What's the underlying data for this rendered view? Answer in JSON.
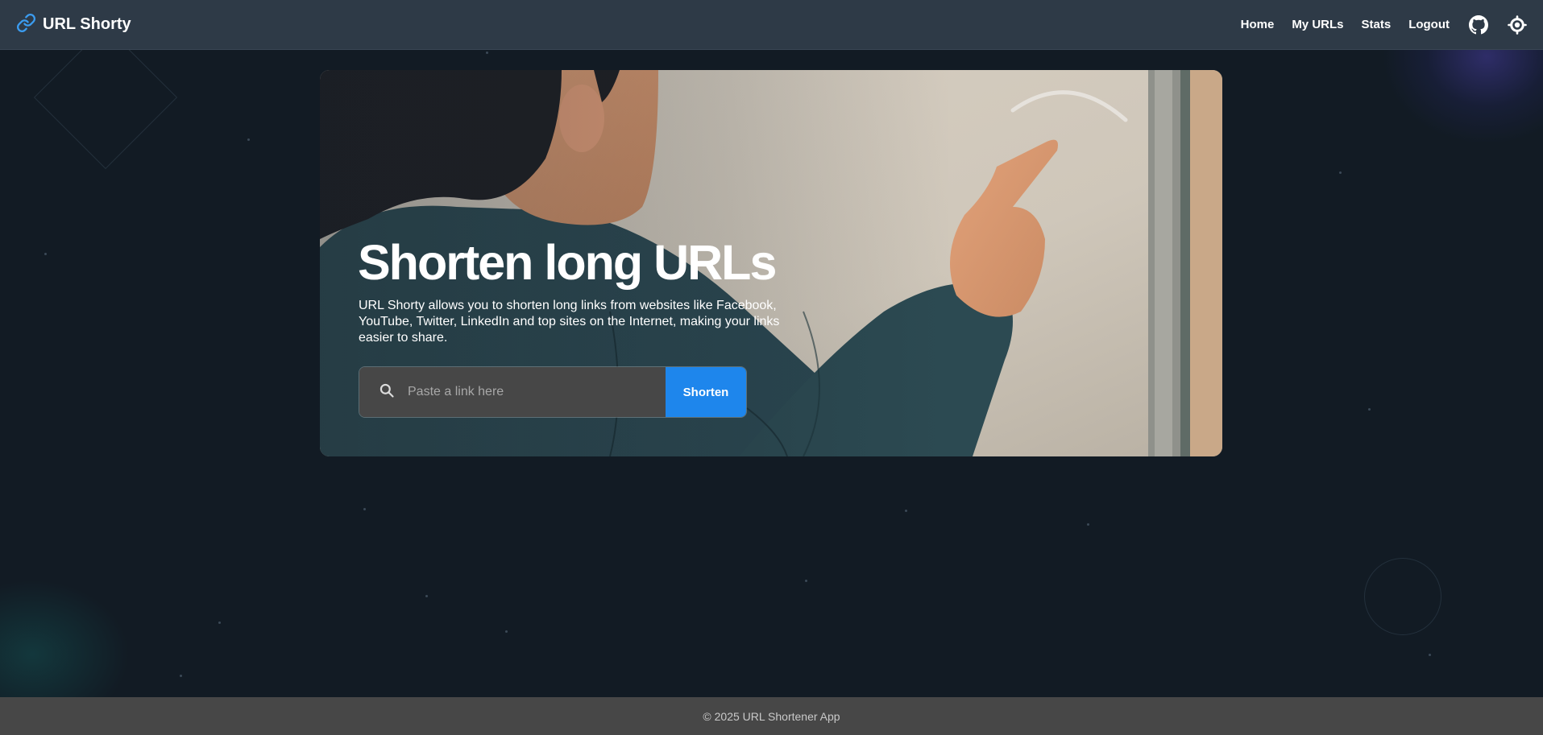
{
  "app": {
    "brand": "URL Shorty",
    "accent_color": "#1e86ec"
  },
  "nav": {
    "links": [
      {
        "label": "Home"
      },
      {
        "label": "My URLs"
      },
      {
        "label": "Stats"
      },
      {
        "label": "Logout"
      }
    ],
    "icons": [
      "github-icon",
      "theme-toggle-icon"
    ]
  },
  "hero": {
    "title": "Shorten long URLs",
    "description": "URL Shorty allows you to shorten long links from websites like Facebook, YouTube, Twitter, LinkedIn and top sites on the Internet, making your links easier to share.",
    "search": {
      "placeholder": "Paste a link here",
      "value": "",
      "button_label": "Shorten"
    }
  },
  "footer": {
    "text": "© 2025 URL Shortener App"
  }
}
